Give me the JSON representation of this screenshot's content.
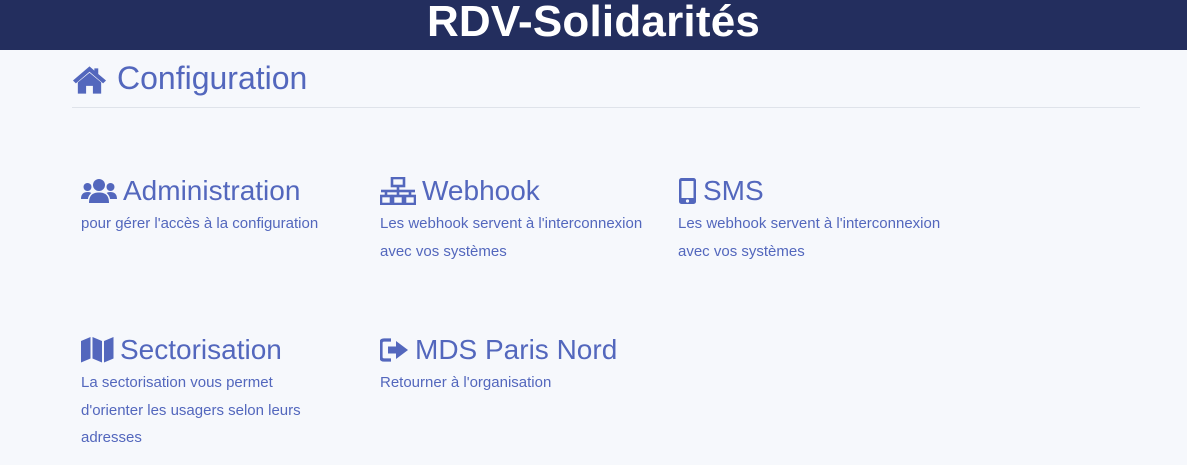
{
  "brand": "RDV-Solidarités",
  "page": {
    "title": "Configuration",
    "icon": "home-icon"
  },
  "cards": [
    {
      "title": "Administration",
      "icon": "users-icon",
      "description": "pour gérer l'accès à la configuration"
    },
    {
      "title": "Webhook",
      "icon": "network-icon",
      "description": "Les webhook servent à l'interconnexion avec vos systèmes"
    },
    {
      "title": "SMS",
      "icon": "mobile-icon",
      "description": "Les webhook servent à l'interconnexion avec vos systèmes"
    },
    {
      "title": "Sectorisation",
      "icon": "map-icon",
      "description": "La sectorisation vous permet d'orienter les usagers selon leurs adresses"
    },
    {
      "title": "MDS Paris Nord",
      "icon": "sign-out-icon",
      "description": "Retourner à l'organisation"
    }
  ],
  "colors": {
    "navbar": "#232e5e",
    "accent": "#5367bd",
    "background": "#f6f8fc"
  }
}
